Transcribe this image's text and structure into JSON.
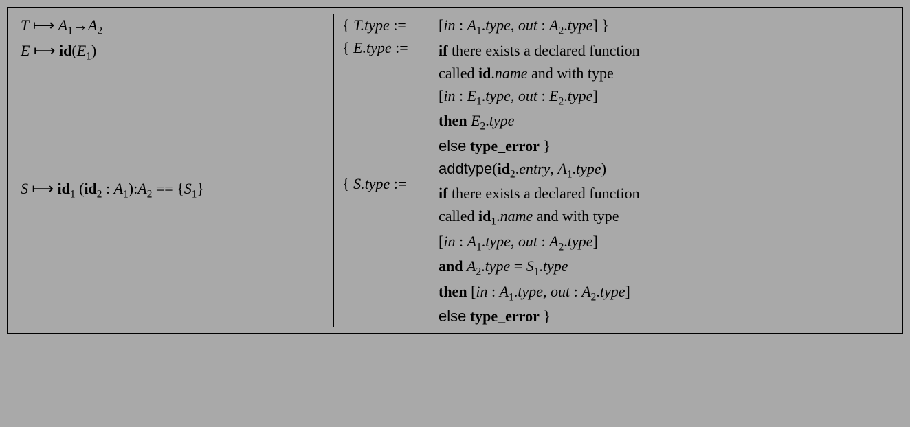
{
  "rules": {
    "r1": {
      "production": "T ⟼ A₁→A₂",
      "lhs": "{ T.type :=",
      "rhs": [
        "[in : A₁.type, out : A₂.type] }"
      ]
    },
    "r2": {
      "production": "E ⟼ id(E₁)",
      "lhs": "{ E.type :=",
      "rhs": [
        "if there exists a declared function",
        "called id.name and with type",
        "[in : E₁.type, out : E₂.type]",
        "then E₂.type",
        "else type_error }"
      ]
    },
    "r3": {
      "production": "S ⟼ id₁ (id₂ : A₁):A₂ == {S₁}",
      "lhs": "{ S.type :=",
      "rhs": [
        "addtype(id₂.entry, A₁.type)",
        "if there exists a declared function",
        "called id₁.name and with type",
        "[in : A₁.type, out : A₂.type]",
        "and A₂.type = S₁.type",
        "then [in : A₁.type, out : A₂.type]",
        "else type_error }"
      ]
    }
  }
}
